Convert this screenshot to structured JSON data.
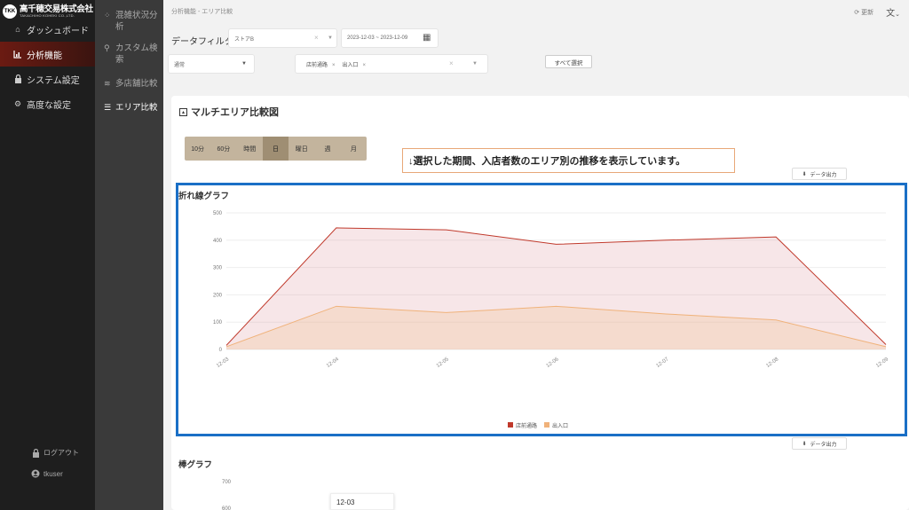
{
  "logo": {
    "mark": "TKK",
    "name": "高千穂交易株式会社",
    "sub": "TAKACHIHO KOHEKI CO.,LTD."
  },
  "sidebar": {
    "items": [
      {
        "label": "ダッシュボード",
        "icon": "home-icon"
      },
      {
        "label": "分析機能",
        "icon": "chart-icon"
      },
      {
        "label": "システム設定",
        "icon": "lock-icon"
      },
      {
        "label": "高度な設定",
        "icon": "gears-icon"
      }
    ],
    "logout": "ログアウト",
    "user": "tkuser"
  },
  "subbar": {
    "items": [
      {
        "label": "混雑状況分析",
        "icon": "dots-icon"
      },
      {
        "label": "カスタム検索",
        "icon": "search-icon"
      },
      {
        "label": "多店舗比較",
        "icon": "stack-icon"
      },
      {
        "label": "エリア比較",
        "icon": "database-icon"
      }
    ]
  },
  "header": {
    "breadcrumb": "分析機能 - エリア比較",
    "refresh": "更新"
  },
  "filters": {
    "label": "データフィルタ",
    "store": "ストアB",
    "date_range": "2023-12-03 ~ 2023-12-09",
    "type": "通常",
    "tags": [
      "店前通路",
      "出入口"
    ],
    "select_all": "すべて選択"
  },
  "card": {
    "title": "マルチエリア比較図",
    "granularity": [
      "10分",
      "60分",
      "時間",
      "日",
      "曜日",
      "週",
      "月"
    ],
    "granularity_active": 3,
    "note": "↓選択した期間、入店者数のエリア別の推移を表示しています。",
    "export_label": "データ出力"
  },
  "line_chart": {
    "title": "折れ線グラフ"
  },
  "bar_chart": {
    "title": "棒グラフ",
    "y_ticks": [
      "700",
      "600"
    ]
  },
  "tooltip": {
    "label": "12-03"
  },
  "colors": {
    "accent": "#1a6fc6",
    "series1": "#c0392b",
    "series2": "#f0b27a",
    "gran_bg": "#c3b49d",
    "gran_active": "#9f8e73"
  },
  "chart_data": {
    "type": "area",
    "x": [
      "12-03",
      "12-04",
      "12-05",
      "12-06",
      "12-07",
      "12-08",
      "12-09"
    ],
    "series": [
      {
        "name": "店前通路",
        "values": [
          15,
          445,
          438,
          385,
          400,
          412,
          18
        ]
      },
      {
        "name": "出入口",
        "values": [
          10,
          158,
          135,
          158,
          130,
          108,
          10
        ]
      }
    ],
    "ylim": [
      0,
      500
    ],
    "y_ticks": [
      0,
      100,
      200,
      300,
      400,
      500
    ],
    "grid": true,
    "legend": "bottom-center"
  }
}
